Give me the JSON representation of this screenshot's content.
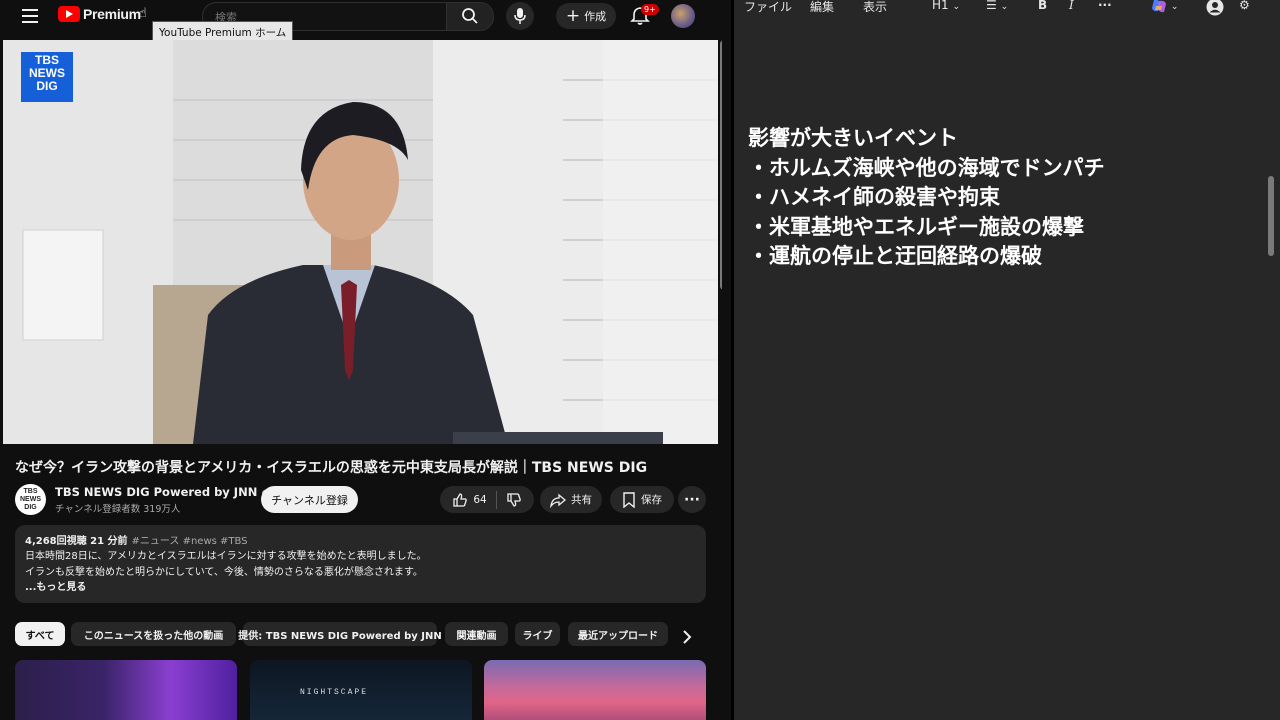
{
  "youtube": {
    "logo_text": "Premium",
    "tooltip": "YouTube Premium ホーム",
    "search_placeholder": "検索",
    "create_label": "作成",
    "notification_badge": "9+",
    "player_logo": [
      "TBS",
      "NEWS",
      "DIG"
    ],
    "video_title": "なぜ今？イラン攻撃の背景とアメリカ・イスラエルの思惑を元中東支局長が解説｜TBS NEWS DIG",
    "channel": {
      "avatar_text": [
        "TBS",
        "NEWS",
        "DIG"
      ],
      "name": "TBS NEWS DIG Powered by JNN",
      "subscribers": "チャンネル登録者数 319万人",
      "subscribe_label": "チャンネル登録"
    },
    "actions": {
      "like_count": "64",
      "share_label": "共有",
      "save_label": "保存"
    },
    "description": {
      "views_time": "4,268回視聴  21 分前",
      "hashtags": "#ニュース #news #TBS",
      "line1": "日本時間28日に、アメリカとイスラエルはイランに対する攻撃を始めたと表明しました。",
      "line2": "イランも反撃を始めたと明らかにしていて、今後、情勢のさらなる悪化が懸念されます。",
      "more_label": "...もっと見る"
    },
    "chips": [
      "すべて",
      "このニュースを扱った他の動画",
      "提供: TBS NEWS DIG Powered by JNN",
      "関連動画",
      "ライブ",
      "最近アップロード"
    ],
    "thumbnail_text": "NIGHTSCAPE"
  },
  "notepad": {
    "menu": [
      "ファイル",
      "編集",
      "表示"
    ],
    "heading_selector": "H1",
    "bold_label": "B",
    "italic_label": "I",
    "more_label": "···",
    "lines": [
      "影響が大きいイベント",
      "・ホルムズ海峡や他の海域でドンパチ",
      "・ハメネイ師の殺害や拘束",
      "・米軍基地やエネルギー施設の爆撃",
      "・運航の停止と迂回経路の爆破"
    ]
  },
  "colors": {
    "youtube_bg": "#0f0f0f",
    "youtube_red": "#ff0000",
    "pill_bg": "#272727",
    "notepad_bg": "#272727",
    "tbs_blue": "#1560d8"
  }
}
